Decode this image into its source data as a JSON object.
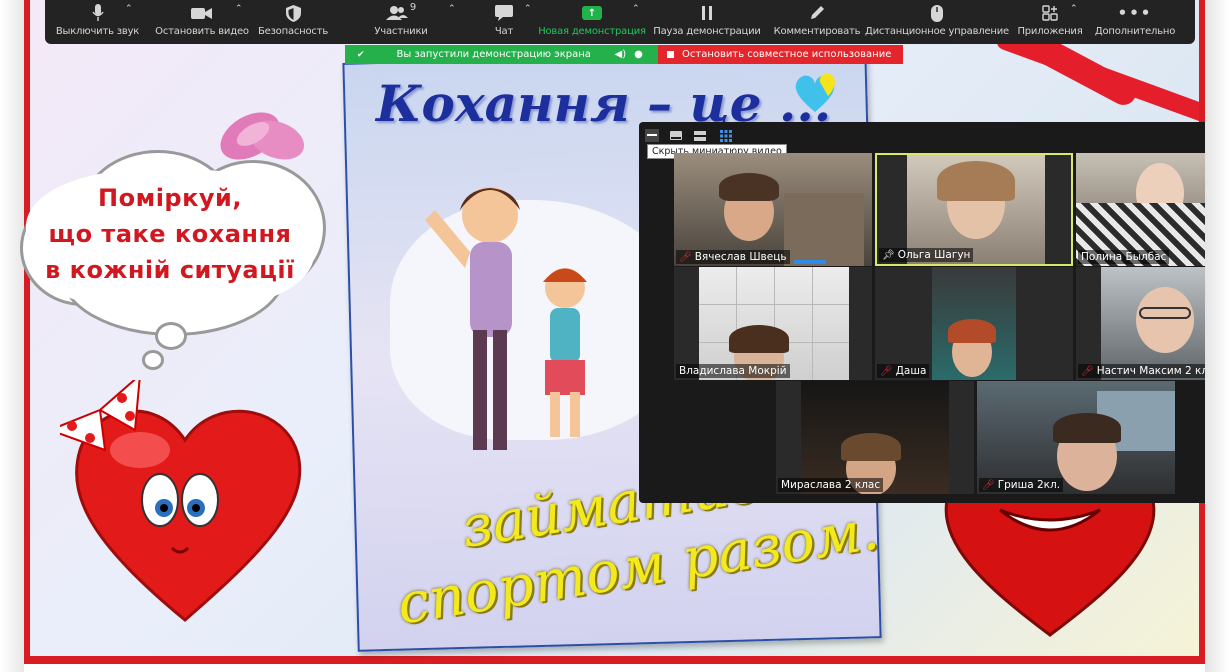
{
  "toolbar": {
    "items": [
      {
        "label": "Выключить звук",
        "icon": "microphone-icon",
        "has_caret": true
      },
      {
        "label": "Остановить видео",
        "icon": "video-camera-icon",
        "has_caret": true
      },
      {
        "label": "Безопасность",
        "icon": "shield-icon",
        "has_caret": false
      },
      {
        "label": "Участники",
        "icon": "participants-icon",
        "count": "9",
        "has_caret": true
      },
      {
        "label": "Чат",
        "icon": "chat-bubble-icon",
        "has_caret": true
      },
      {
        "label": "Новая демонстрация",
        "icon": "share-screen-icon",
        "has_caret": true,
        "highlight": "#22c55e"
      },
      {
        "label": "Пауза демонстрации",
        "icon": "pause-icon",
        "has_caret": false
      },
      {
        "label": "Комментировать",
        "icon": "pencil-icon",
        "has_caret": false
      },
      {
        "label": "Дистанционное управление",
        "icon": "mouse-icon",
        "has_caret": false
      },
      {
        "label": "Приложения",
        "icon": "apps-icon",
        "has_caret": true
      },
      {
        "label": "Дополнительно",
        "icon": "more-icon",
        "has_caret": false
      }
    ]
  },
  "share_banner": {
    "status_text": "Вы запустили демонстрацию экрана",
    "stop_text": "Остановить совместное использование"
  },
  "gallery": {
    "tooltip": "Скрыть миниатюру видео",
    "participants": [
      {
        "name": "Вячеслав Швець",
        "muted": true,
        "pinned": false
      },
      {
        "name": "Ольга Шагун",
        "muted": false,
        "pinned": true,
        "active_speaker": true
      },
      {
        "name": "Полина Былбас",
        "muted": false,
        "pinned": false
      },
      {
        "name": "Владислава Мокрій",
        "muted": false,
        "pinned": false
      },
      {
        "name": "Даша",
        "muted": true,
        "pinned": false
      },
      {
        "name": "Настич Максим 2 кл",
        "muted": true,
        "pinned": false
      },
      {
        "name": "Мираслава 2 клас",
        "muted": false,
        "pinned": false
      },
      {
        "name": "Гриша 2кл.",
        "muted": true,
        "pinned": false
      }
    ]
  },
  "slide": {
    "cloud_text_line1": "Поміркуй,",
    "cloud_text_line2": "що таке кохання",
    "cloud_text_line3": "в кожній ситуації",
    "poster_title": "Кохання – це ...",
    "poster_line1": "займатися",
    "poster_line2": "спортом разом."
  },
  "colors": {
    "toolbar_bg": "#232323",
    "share_green": "#24b04b",
    "stop_red": "#e3262b",
    "slide_border": "#d81c24",
    "active_speaker_border": "#d8e86a"
  }
}
